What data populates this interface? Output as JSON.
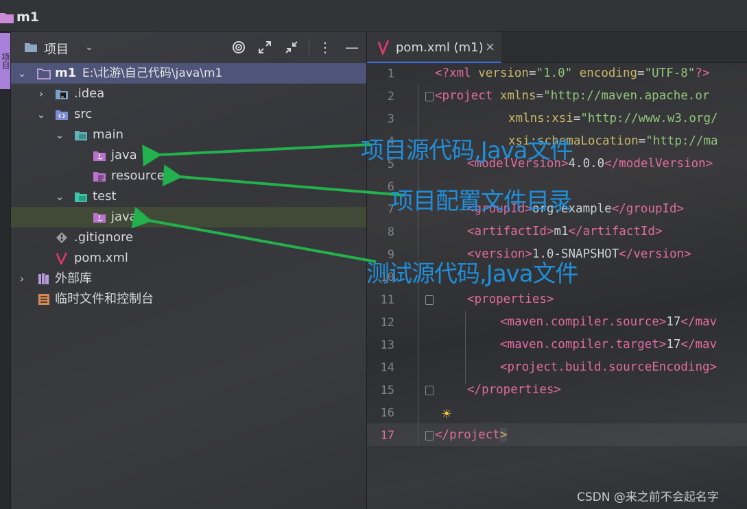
{
  "window": {
    "title": "m1"
  },
  "toolstrip": {
    "tab_label": "项目"
  },
  "project_panel": {
    "title": "项目",
    "tree": [
      {
        "label": "m1",
        "path": "E:\\北游\\自己代码\\java\\m1",
        "icon": "module-folder-icon",
        "expanded": true
      },
      {
        "label": ".idea",
        "icon": "idea-folder-icon",
        "expanded": false
      },
      {
        "label": "src",
        "icon": "source-folder-icon",
        "expanded": true
      },
      {
        "label": "main",
        "icon": "folder-icon",
        "expanded": true
      },
      {
        "label": "java",
        "icon": "java-source-root-icon"
      },
      {
        "label": "resources",
        "icon": "resources-root-icon"
      },
      {
        "label": "test",
        "icon": "test-folder-icon",
        "expanded": true
      },
      {
        "label": "java",
        "icon": "java-test-root-icon"
      },
      {
        "label": ".gitignore",
        "icon": "git-ignore-icon"
      },
      {
        "label": "pom.xml",
        "icon": "maven-icon"
      },
      {
        "label": "外部库",
        "icon": "library-icon",
        "expanded": false
      },
      {
        "label": "临时文件和控制台",
        "icon": "scratch-icon"
      }
    ]
  },
  "editor": {
    "tab_label": "pom.xml (m1)",
    "tab_close": "×",
    "line_numbers": [
      "1",
      "2",
      "3",
      "4",
      "5",
      "6",
      "7",
      "8",
      "9",
      "10",
      "11",
      "12",
      "13",
      "14",
      "15",
      "16",
      "17"
    ],
    "current_line": "17",
    "code": {
      "l1_a": "<?xml ",
      "l1_b": "version",
      "l1_c": "=",
      "l1_d": "\"1.0\"",
      "l1_e": " encoding",
      "l1_f": "=",
      "l1_g": "\"UTF-8\"",
      "l1_h": "?>",
      "l2_a": "<project ",
      "l2_b": "xmlns",
      "l2_c": "=",
      "l2_d": "\"http://maven.apache.or",
      "l3_b": "xmlns:xsi",
      "l3_c": "=",
      "l3_d": "\"http://www.w3.org/",
      "l4_b": "xsi:schemaLocation",
      "l4_c": "=",
      "l4_d": "\"http://ma",
      "l5_a": "<modelVersion>",
      "l5_b": "4.0.0",
      "l5_c": "</modelVersion>",
      "l7_a": "<groupId>",
      "l7_b": "org.example",
      "l7_c": "</groupId>",
      "l8_a": "<artifactId>",
      "l8_b": "m1",
      "l8_c": "</artifactId>",
      "l9_a": "<version>",
      "l9_b": "1.0-SNAPSHOT",
      "l9_c": "</version>",
      "l11_a": "<properties>",
      "l12_a": "<maven.compiler.source>",
      "l12_b": "17",
      "l12_c": "</mav",
      "l13_a": "<maven.compiler.target>",
      "l13_b": "17",
      "l13_c": "</mav",
      "l14_a": "<project.build.sourceEncoding>",
      "l15_a": "</properties>",
      "l17_a": "</project",
      "l17_b": ">"
    }
  },
  "annotations": {
    "main_java": "项目源代码,Java文件",
    "resources": "项目配置文件目录",
    "test_java": "测试源代码,Java文件"
  },
  "watermark": "CSDN @来之前不会起名字",
  "colors": {
    "arrow": "#22b14c",
    "annotation": "#1f8ed9",
    "selection": "#4f5578",
    "accent_tab": "#3d6ee0"
  }
}
